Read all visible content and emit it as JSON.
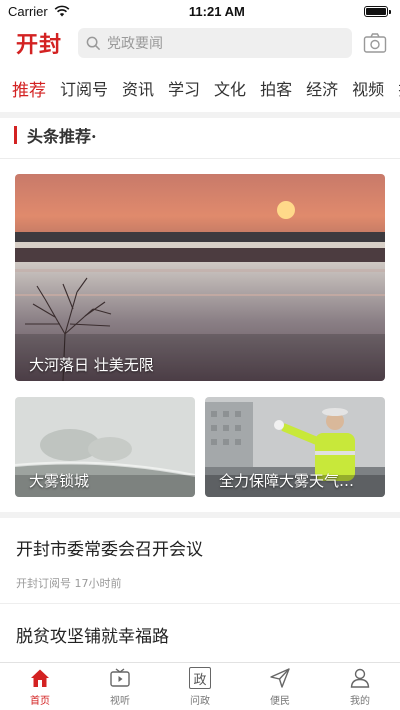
{
  "status": {
    "carrier": "Carrier",
    "time": "11:21 AM"
  },
  "header": {
    "logo": "开封",
    "search_placeholder": "党政要闻"
  },
  "tabs": [
    "推荐",
    "订阅号",
    "资讯",
    "学习",
    "文化",
    "拍客",
    "经济",
    "视频",
    "拉"
  ],
  "section": {
    "title": "头条推荐·"
  },
  "hero": {
    "caption": "大河落日 壮美无限"
  },
  "cards": [
    {
      "caption": "大雾锁城"
    },
    {
      "caption": "全力保障大雾天气…"
    }
  ],
  "articles": [
    {
      "title": "开封市委常委会召开会议",
      "meta": "开封订阅号  17小时前"
    },
    {
      "title": "脱贫攻坚铺就幸福路"
    }
  ],
  "bottom_nav": [
    {
      "label": "首页",
      "icon": "home-icon",
      "active": true
    },
    {
      "label": "视听",
      "icon": "tv-icon",
      "active": false
    },
    {
      "label": "问政",
      "icon": "zheng-icon",
      "glyph": "政",
      "active": false
    },
    {
      "label": "便民",
      "icon": "send-icon",
      "active": false
    },
    {
      "label": "我的",
      "icon": "user-icon",
      "active": false
    }
  ],
  "colors": {
    "accent": "#d32222"
  }
}
